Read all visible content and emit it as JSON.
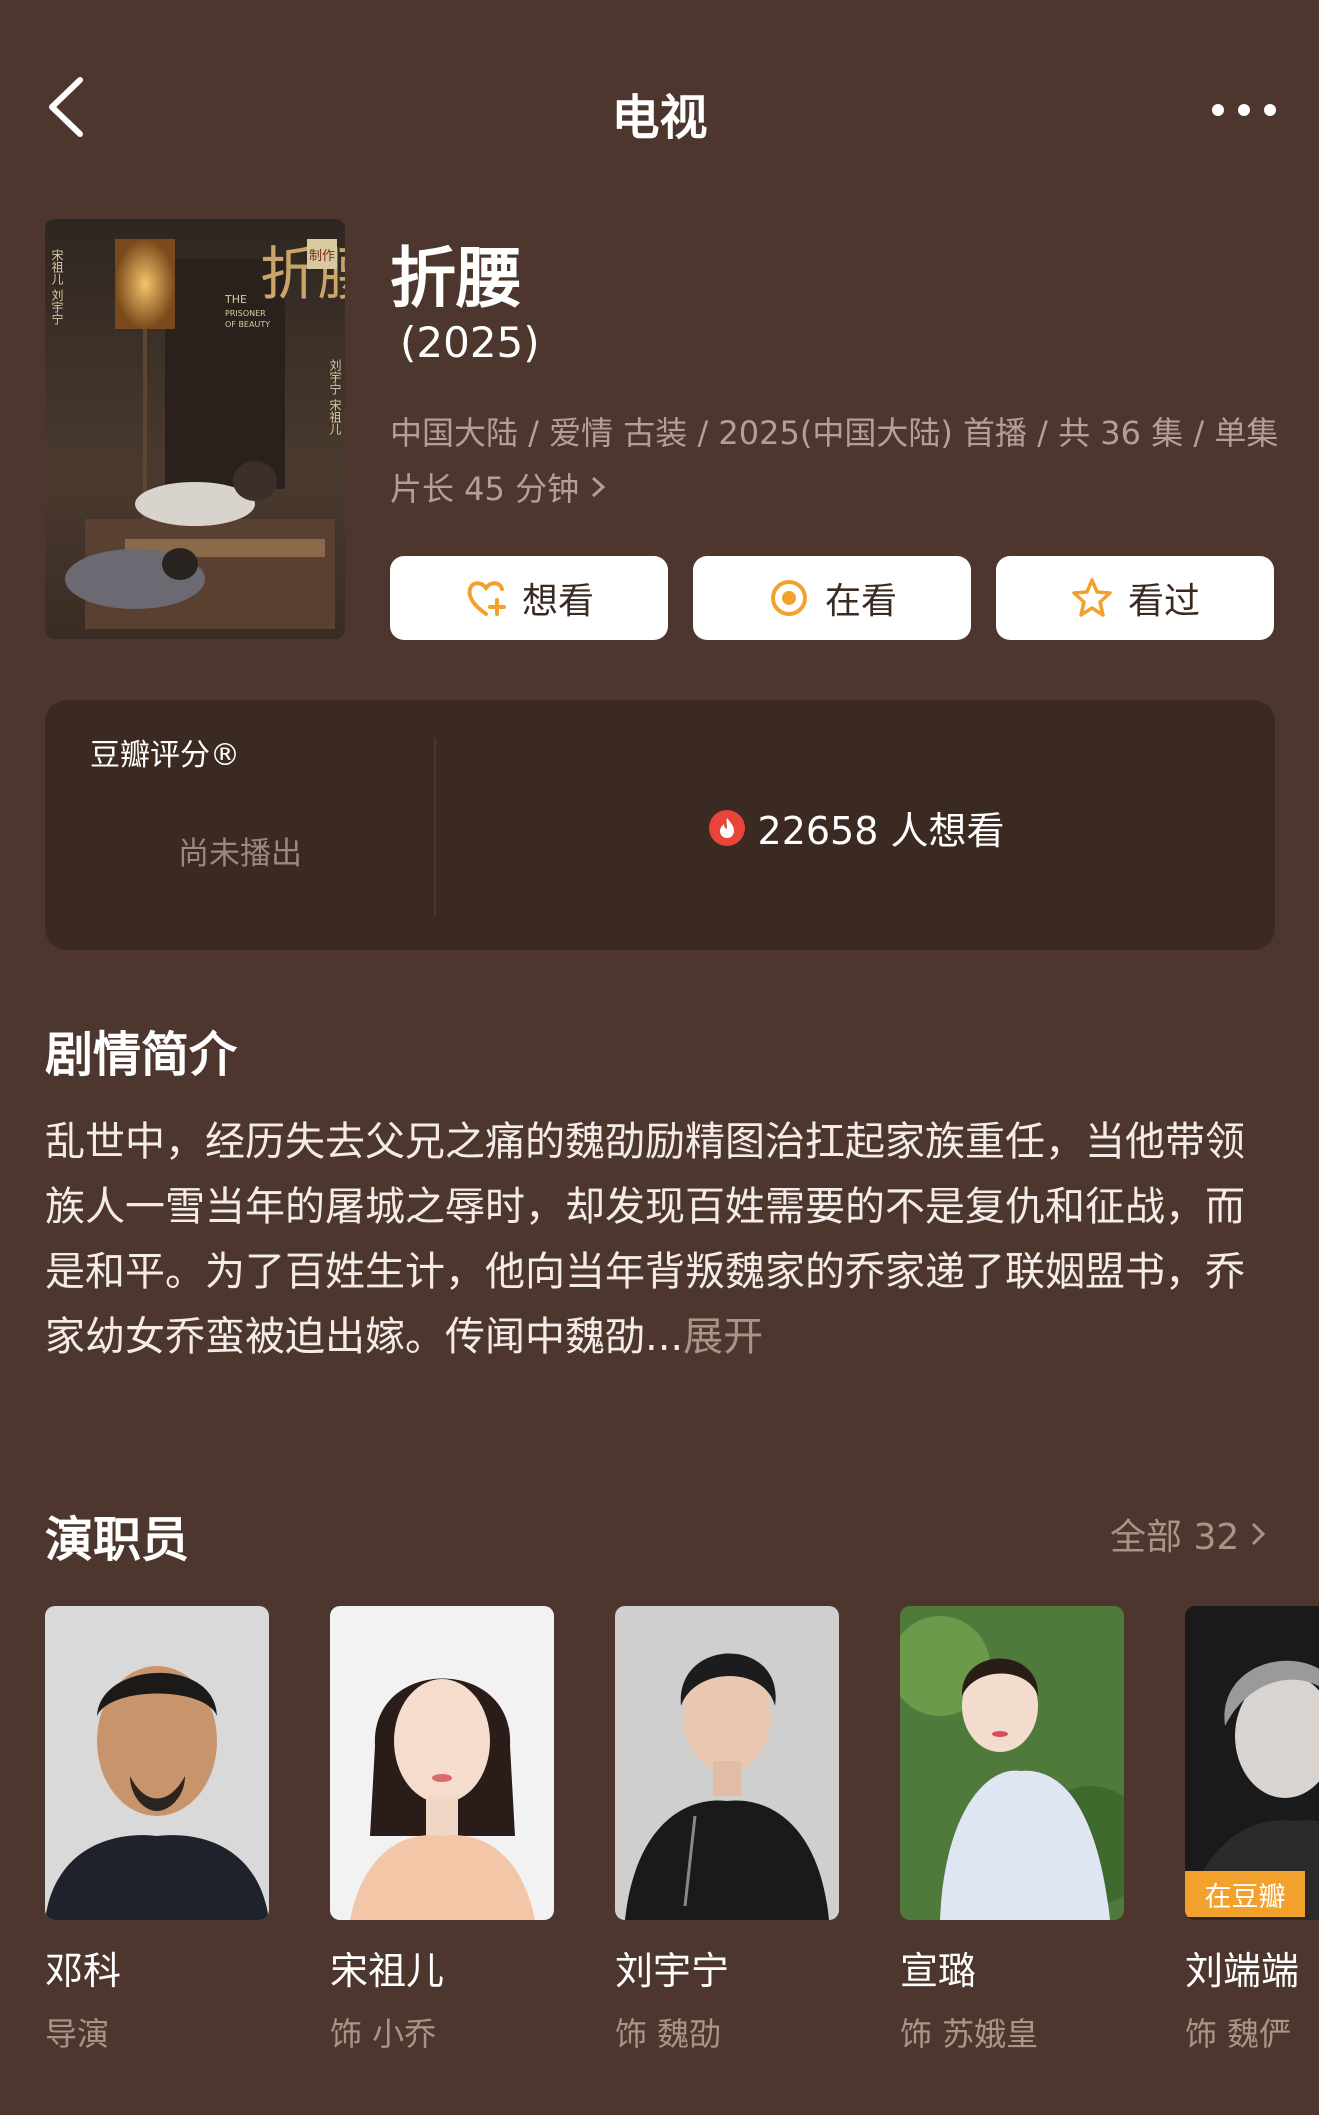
{
  "header": {
    "title": "电视"
  },
  "show": {
    "title": "折腰",
    "year": "(2025)",
    "meta": "中国大陆 / 爱情 古装 / 2025(中国大陆) 首播 / 共 36 集 / 单集片长 45 分钟",
    "poster_texts": {
      "title": "折腰",
      "seal": "制作",
      "english_1": "THE",
      "english_2": "PRISONER",
      "english_3": "OF BEAUTY",
      "left_names": "宋祖儿 刘宇宁",
      "right_names": "刘宇宁 宋祖儿"
    }
  },
  "actions": {
    "want": "想看",
    "watching": "在看",
    "watched": "看过"
  },
  "rating": {
    "title": "豆瓣评分®",
    "status": "尚未播出",
    "want_count": "22658 人想看"
  },
  "synopsis": {
    "heading": "剧情简介",
    "text": "乱世中，经历失去父兄之痛的魏劭励精图治扛起家族重任，当他带领族人一雪当年的屠城之辱时，却发现百姓需要的不是复仇和征战，而是和平。为了百姓生计，他向当年背叛魏家的乔家递了联姻盟书，乔家幼女乔蛮被迫出嫁。传闻中魏劭...",
    "expand": "展开"
  },
  "cast": {
    "heading": "演职员",
    "all_label": "全部 32",
    "members": [
      {
        "name": "邓科",
        "role": "导演"
      },
      {
        "name": "宋祖儿",
        "role": "饰 小乔"
      },
      {
        "name": "刘宇宁",
        "role": "饰 魏劭"
      },
      {
        "name": "宣璐",
        "role": "饰 苏娥皇"
      },
      {
        "name": "刘端端",
        "role": "饰 魏俨",
        "badge": "在豆瓣"
      }
    ]
  },
  "colors": {
    "background": "#4d362d",
    "card": "#3b2a22",
    "accent": "#f2a12d",
    "fire": "#e8443a",
    "muted": "#a89489"
  },
  "icons": {
    "back": "chevron-left-icon",
    "more": "more-dots-icon",
    "want": "heart-plus-icon",
    "watching": "target-circle-icon",
    "watched": "star-icon",
    "fire": "fire-icon",
    "chevron": "chevron-right-icon"
  }
}
